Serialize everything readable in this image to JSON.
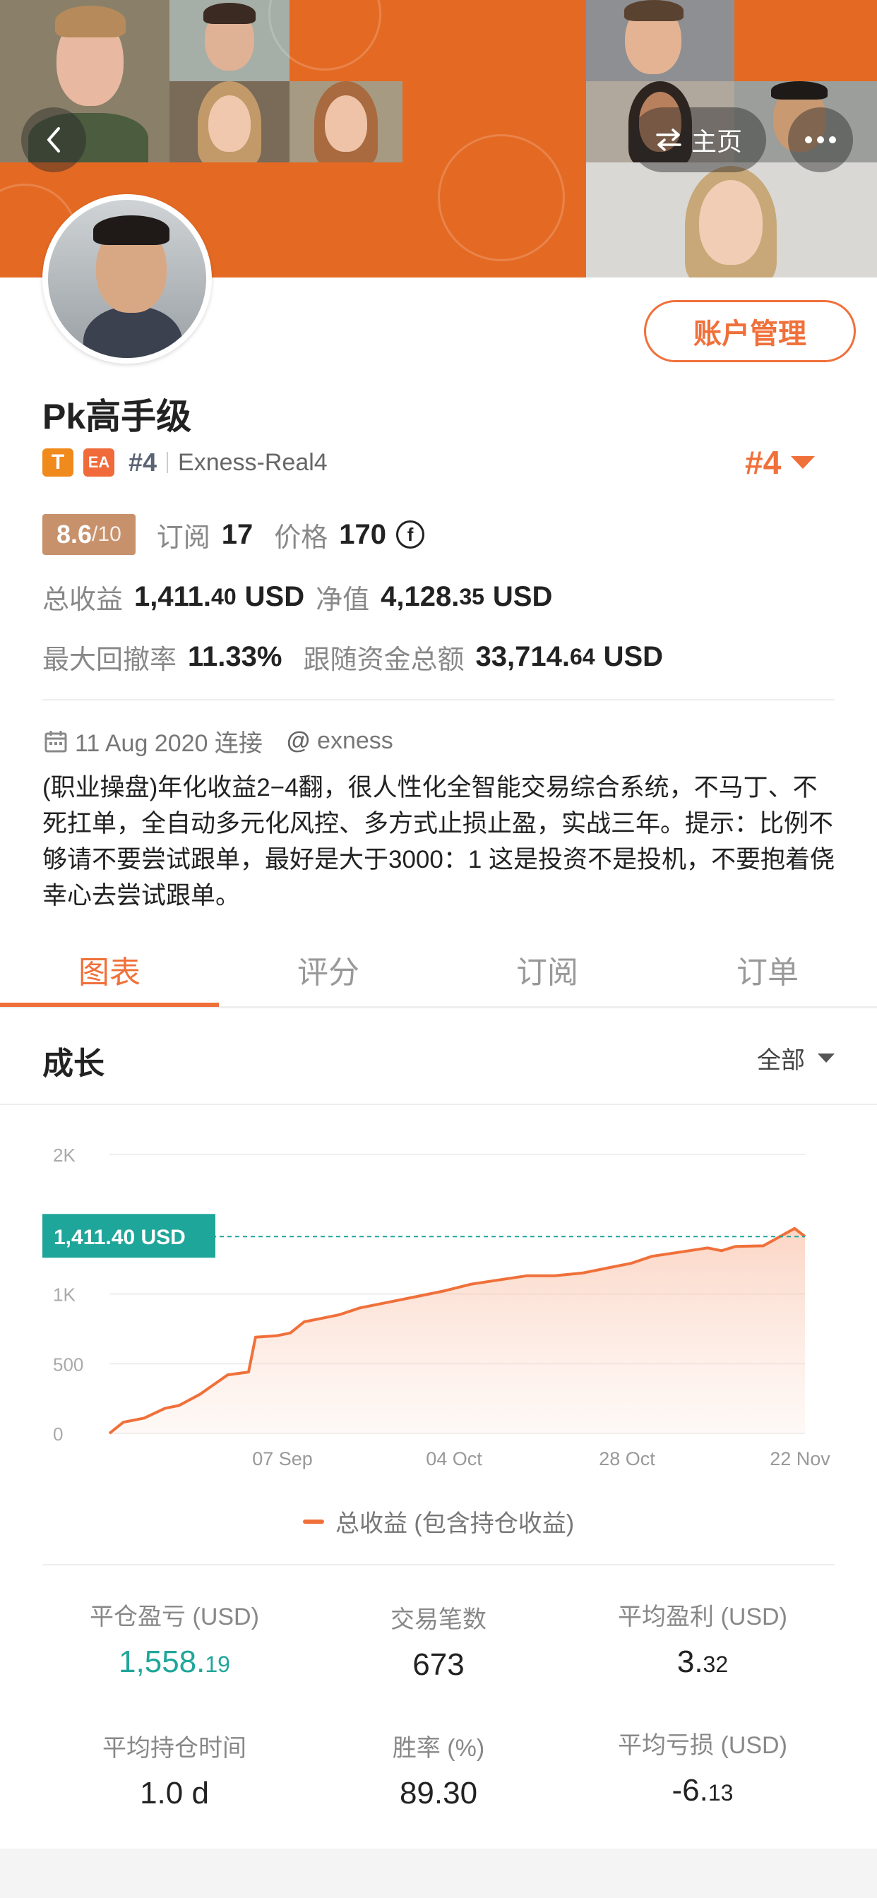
{
  "header": {
    "home_label": "主页",
    "account_button": "账户管理"
  },
  "profile": {
    "name": "Pk高手级",
    "badge_t": "T",
    "badge_ea": "EA",
    "rank_small": "#4",
    "broker": "Exness-Real4",
    "rank_big": "#4",
    "rating": "8.6",
    "rating_denominator": "/10",
    "subscribe_label": "订阅",
    "subscribe_count": "17",
    "price_label": "价格",
    "price_value": "170",
    "price_currency_symbol": "f",
    "total_profit_label": "总收益",
    "total_profit_int": "1,411.",
    "total_profit_dec": "40",
    "total_profit_unit": "USD",
    "net_value_label": "净值",
    "net_value_int": "4,128.",
    "net_value_dec": "35",
    "net_value_unit": "USD",
    "max_drawdown_label": "最大回撤率",
    "max_drawdown_value": "11.33%",
    "follow_funds_label": "跟随资金总额",
    "follow_funds_int": "33,714.",
    "follow_funds_dec": "64",
    "follow_funds_unit": "USD",
    "connect_date": "11 Aug 2020 连接",
    "at_symbol": "@",
    "platform": "exness",
    "description": "(职业操盘)年化收益2−4翻，很人性化全智能交易综合系统，不马丁、不死扛单，全自动多元化风控、多方式止损止盈，实战三年。提示：比例不够请不要尝试跟单，最好是大于3000：1 这是投资不是投机，不要抱着侥幸心去尝试跟单。"
  },
  "tabs": [
    "图表",
    "评分",
    "订阅",
    "订单"
  ],
  "active_tab": 0,
  "growth": {
    "title": "成长",
    "filter": "全部"
  },
  "chart_data": {
    "type": "area",
    "y_ticks": [
      "2K",
      "1K",
      "500",
      "0"
    ],
    "x_ticks": [
      "07 Sep",
      "04 Oct",
      "28 Oct",
      "22 Nov"
    ],
    "current_label": "1,411.40 USD",
    "current_value": 1411.4,
    "ylim": [
      0,
      2000
    ],
    "series": [
      {
        "name": "总收益 (包含持仓收益)",
        "values": [
          [
            0,
            0
          ],
          [
            0.02,
            80
          ],
          [
            0.05,
            110
          ],
          [
            0.08,
            180
          ],
          [
            0.1,
            200
          ],
          [
            0.13,
            280
          ],
          [
            0.15,
            350
          ],
          [
            0.17,
            420
          ],
          [
            0.2,
            440
          ],
          [
            0.21,
            690
          ],
          [
            0.24,
            700
          ],
          [
            0.26,
            720
          ],
          [
            0.28,
            800
          ],
          [
            0.3,
            820
          ],
          [
            0.33,
            850
          ],
          [
            0.36,
            900
          ],
          [
            0.4,
            940
          ],
          [
            0.44,
            980
          ],
          [
            0.48,
            1020
          ],
          [
            0.52,
            1070
          ],
          [
            0.56,
            1100
          ],
          [
            0.6,
            1130
          ],
          [
            0.64,
            1130
          ],
          [
            0.68,
            1150
          ],
          [
            0.72,
            1190
          ],
          [
            0.75,
            1220
          ],
          [
            0.78,
            1270
          ],
          [
            0.82,
            1300
          ],
          [
            0.86,
            1330
          ],
          [
            0.88,
            1310
          ],
          [
            0.9,
            1340
          ],
          [
            0.94,
            1345
          ],
          [
            0.96,
            1400
          ],
          [
            0.985,
            1470
          ],
          [
            1.0,
            1411.4
          ]
        ],
        "color": "#f0703a"
      }
    ]
  },
  "legend_label": "总收益 (包含持仓收益)",
  "metrics": [
    {
      "label": "平仓盈亏 (USD)",
      "int": "1,558.",
      "dec": "19",
      "green": true
    },
    {
      "label": "交易笔数",
      "int": "673",
      "dec": "",
      "green": false
    },
    {
      "label": "平均盈利 (USD)",
      "int": "3.",
      "dec": "32",
      "green": false
    },
    {
      "label": "平均持仓时间",
      "int": "1.0 d",
      "dec": "",
      "green": false
    },
    {
      "label": "胜率 (%)",
      "int": "89.30",
      "dec": "",
      "green": false
    },
    {
      "label": "平均亏损 (USD)",
      "int": "-6.",
      "dec": "13",
      "green": false
    }
  ],
  "colors": {
    "accent": "#f0703a",
    "green": "#1fa69a",
    "rating_bg": "#c7916b"
  }
}
